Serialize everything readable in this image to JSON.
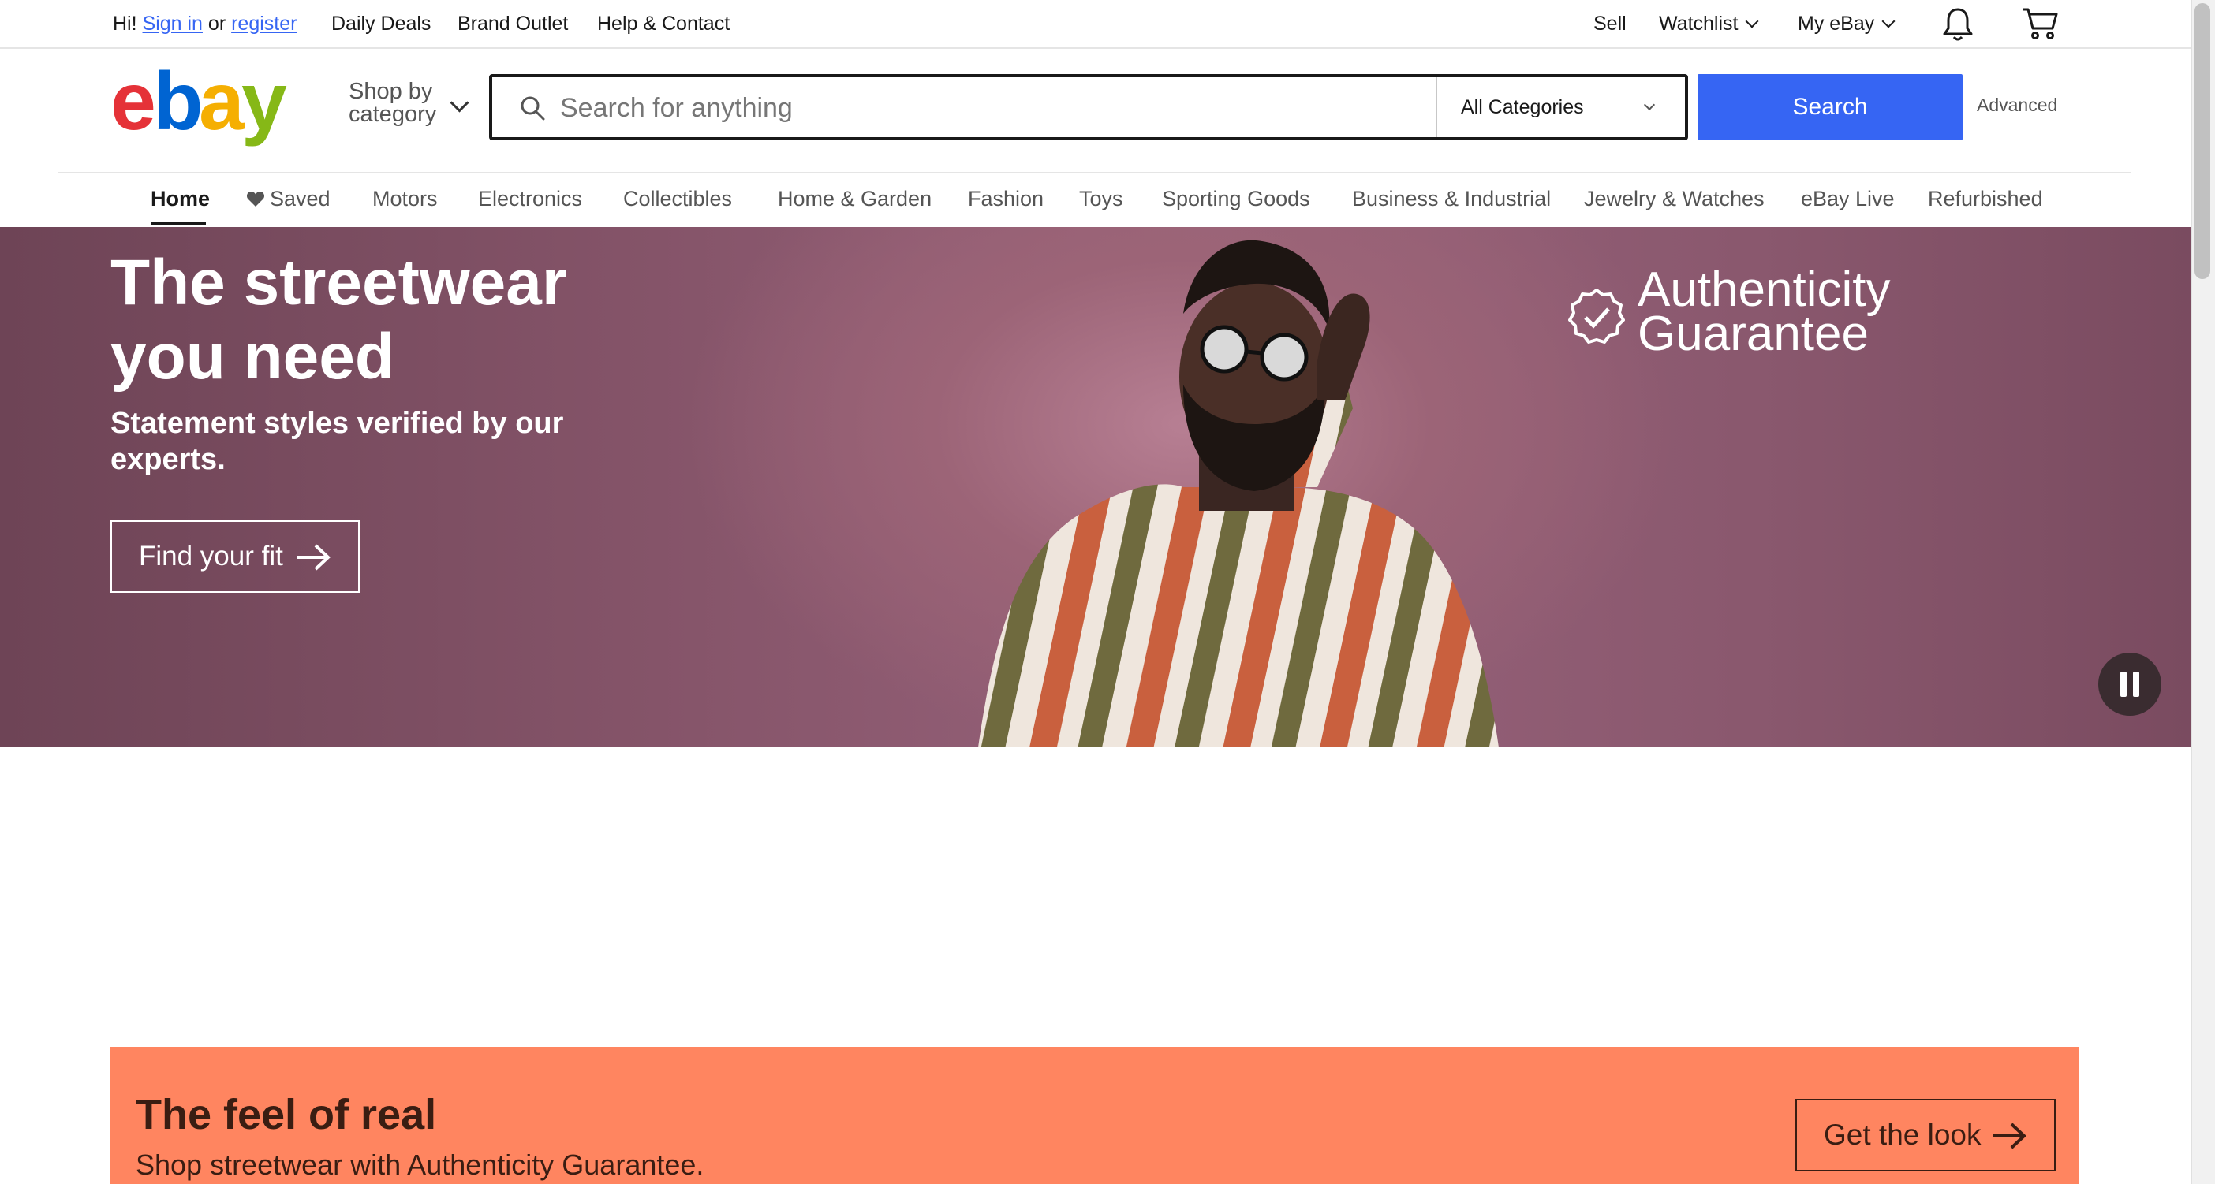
{
  "topbar": {
    "greeting": "Hi!",
    "sign_in": "Sign in",
    "or": "or",
    "register": "register",
    "links": [
      "Daily Deals",
      "Brand Outlet",
      "Help & Contact"
    ],
    "sell": "Sell",
    "watchlist": "Watchlist",
    "my_ebay": "My eBay"
  },
  "header": {
    "shop_by_line1": "Shop by",
    "shop_by_line2": "category",
    "search_placeholder": "Search for anything",
    "category_selected": "All Categories",
    "search_button": "Search",
    "advanced": "Advanced"
  },
  "nav": {
    "items": [
      "Home",
      "Saved",
      "Motors",
      "Electronics",
      "Collectibles",
      "Home & Garden",
      "Fashion",
      "Toys",
      "Sporting Goods",
      "Business & Industrial",
      "Jewelry & Watches",
      "eBay Live",
      "Refurbished"
    ]
  },
  "hero": {
    "title": "The streetwear you need",
    "subtitle": "Statement styles verified by our experts.",
    "cta": "Find your fit",
    "badge_line1": "Authenticity",
    "badge_line2": "Guarantee"
  },
  "promo": {
    "title": "The feel of real",
    "subtitle": "Shop streetwear with Authenticity Guarantee.",
    "cta": "Get the look",
    "color": "#ff8560"
  },
  "colors": {
    "accent": "#3665f3",
    "logo_e": "#e53238",
    "logo_b": "#0064d2",
    "logo_a": "#f5af02",
    "logo_y": "#86b817"
  },
  "icons": {
    "notifications": "bell-icon",
    "cart": "cart-icon",
    "search": "search-icon",
    "saved": "heart-icon",
    "pause": "pause-icon",
    "arrow": "arrow-right-icon",
    "badge": "check-badge-icon"
  }
}
